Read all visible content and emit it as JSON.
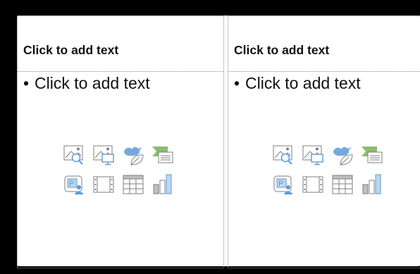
{
  "slide": {
    "left": {
      "title_placeholder": "Click to add text",
      "body_bullet": "•",
      "body_placeholder": "Click to add text"
    },
    "right": {
      "title_placeholder": "Click to add text",
      "body_bullet": "•",
      "body_placeholder": "Click to add text"
    }
  },
  "content_insert_icons": [
    "insert-picture-icon",
    "insert-online-picture-icon",
    "insert-icons-icon",
    "insert-smartart-icon",
    "insert-cameo-icon",
    "insert-video-icon",
    "insert-table-icon",
    "insert-chart-icon"
  ],
  "colors": {
    "icon_blue": "#5b9bd5",
    "icon_green": "#70ad47",
    "icon_gray": "#7f7f7f"
  }
}
